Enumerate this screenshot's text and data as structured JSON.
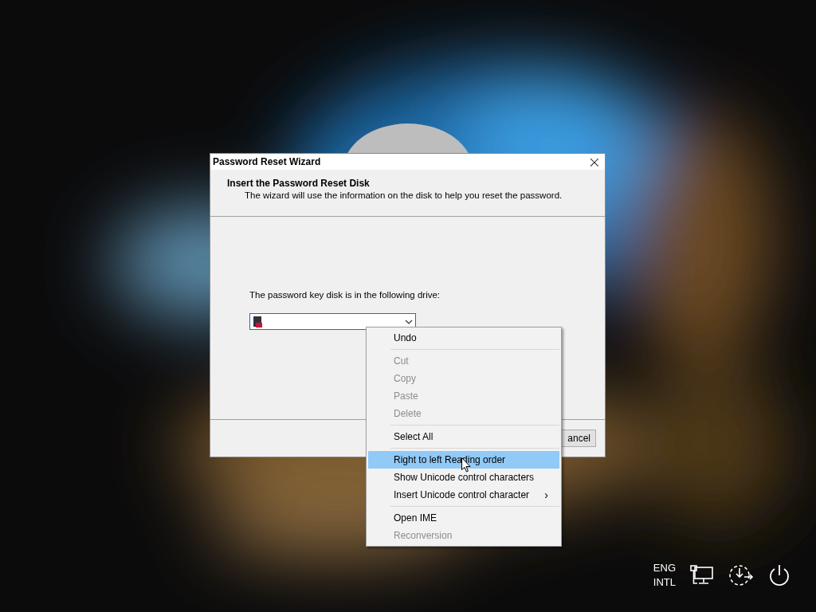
{
  "dialog": {
    "title": "Password Reset Wizard",
    "close_glyph": "×",
    "heading": "Insert the Password Reset Disk",
    "subheading": "The wizard will use the information on the disk to help you reset the password.",
    "drive_label": "The password key disk is in the following drive:",
    "cancel_button": "ancel"
  },
  "context_menu": [
    {
      "kind": "item",
      "label": "Undo",
      "disabled": false,
      "selected": false
    },
    {
      "kind": "separator"
    },
    {
      "kind": "item",
      "label": "Cut",
      "disabled": true,
      "selected": false
    },
    {
      "kind": "item",
      "label": "Copy",
      "disabled": true,
      "selected": false
    },
    {
      "kind": "item",
      "label": "Paste",
      "disabled": true,
      "selected": false
    },
    {
      "kind": "item",
      "label": "Delete",
      "disabled": true,
      "selected": false
    },
    {
      "kind": "separator"
    },
    {
      "kind": "item",
      "label": "Select All",
      "disabled": false,
      "selected": false
    },
    {
      "kind": "separator"
    },
    {
      "kind": "item",
      "label": "Right to left Reading order",
      "disabled": false,
      "selected": true
    },
    {
      "kind": "item",
      "label": "Show Unicode control characters",
      "disabled": false,
      "selected": false
    },
    {
      "kind": "item",
      "label": "Insert Unicode control character",
      "disabled": false,
      "selected": false,
      "submenu": "›"
    },
    {
      "kind": "separator"
    },
    {
      "kind": "item",
      "label": "Open IME",
      "disabled": false,
      "selected": false
    },
    {
      "kind": "item",
      "label": "Reconversion",
      "disabled": true,
      "selected": false
    }
  ],
  "tray": {
    "language": [
      "ENG",
      "INTL"
    ]
  }
}
